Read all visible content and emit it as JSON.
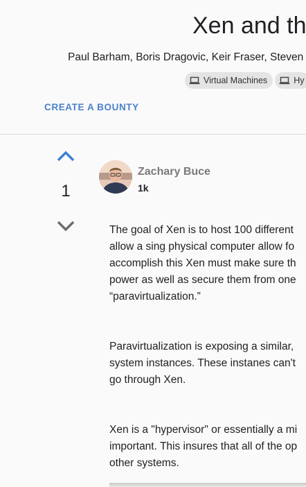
{
  "paper": {
    "title": "Xen and th",
    "authors": "Paul Barham, Boris Dragovic, Keir Fraser, Steven",
    "tags": [
      {
        "label": "Virtual Machines",
        "icon": "laptop-icon"
      },
      {
        "label": "Hy",
        "icon": "laptop-icon"
      }
    ]
  },
  "actions": {
    "bounty_label": "CREATE A BOUNTY"
  },
  "vote": {
    "count": "1"
  },
  "author": {
    "name": "Zachary Buce",
    "reputation": "1k"
  },
  "post": {
    "paragraphs": [
      [
        "The goal of Xen is to host 100 different",
        "allow a sing physical computer allow fo",
        "accomplish this Xen must make sure th",
        "power as well as secure them from one",
        "“paravirtualization.”"
      ],
      [
        "Paravirtualization is exposing a similar,",
        "system instances. These instanes can't",
        "go through Xen."
      ],
      [
        "Xen is a \"hypervisor\" or essentially a mi",
        "important. This insures that all of the op",
        "other systems."
      ]
    ]
  },
  "colors": {
    "accent": "#4a80c9",
    "vote_up": "#3b7fd4",
    "vote_down": "#6b6b6b"
  }
}
